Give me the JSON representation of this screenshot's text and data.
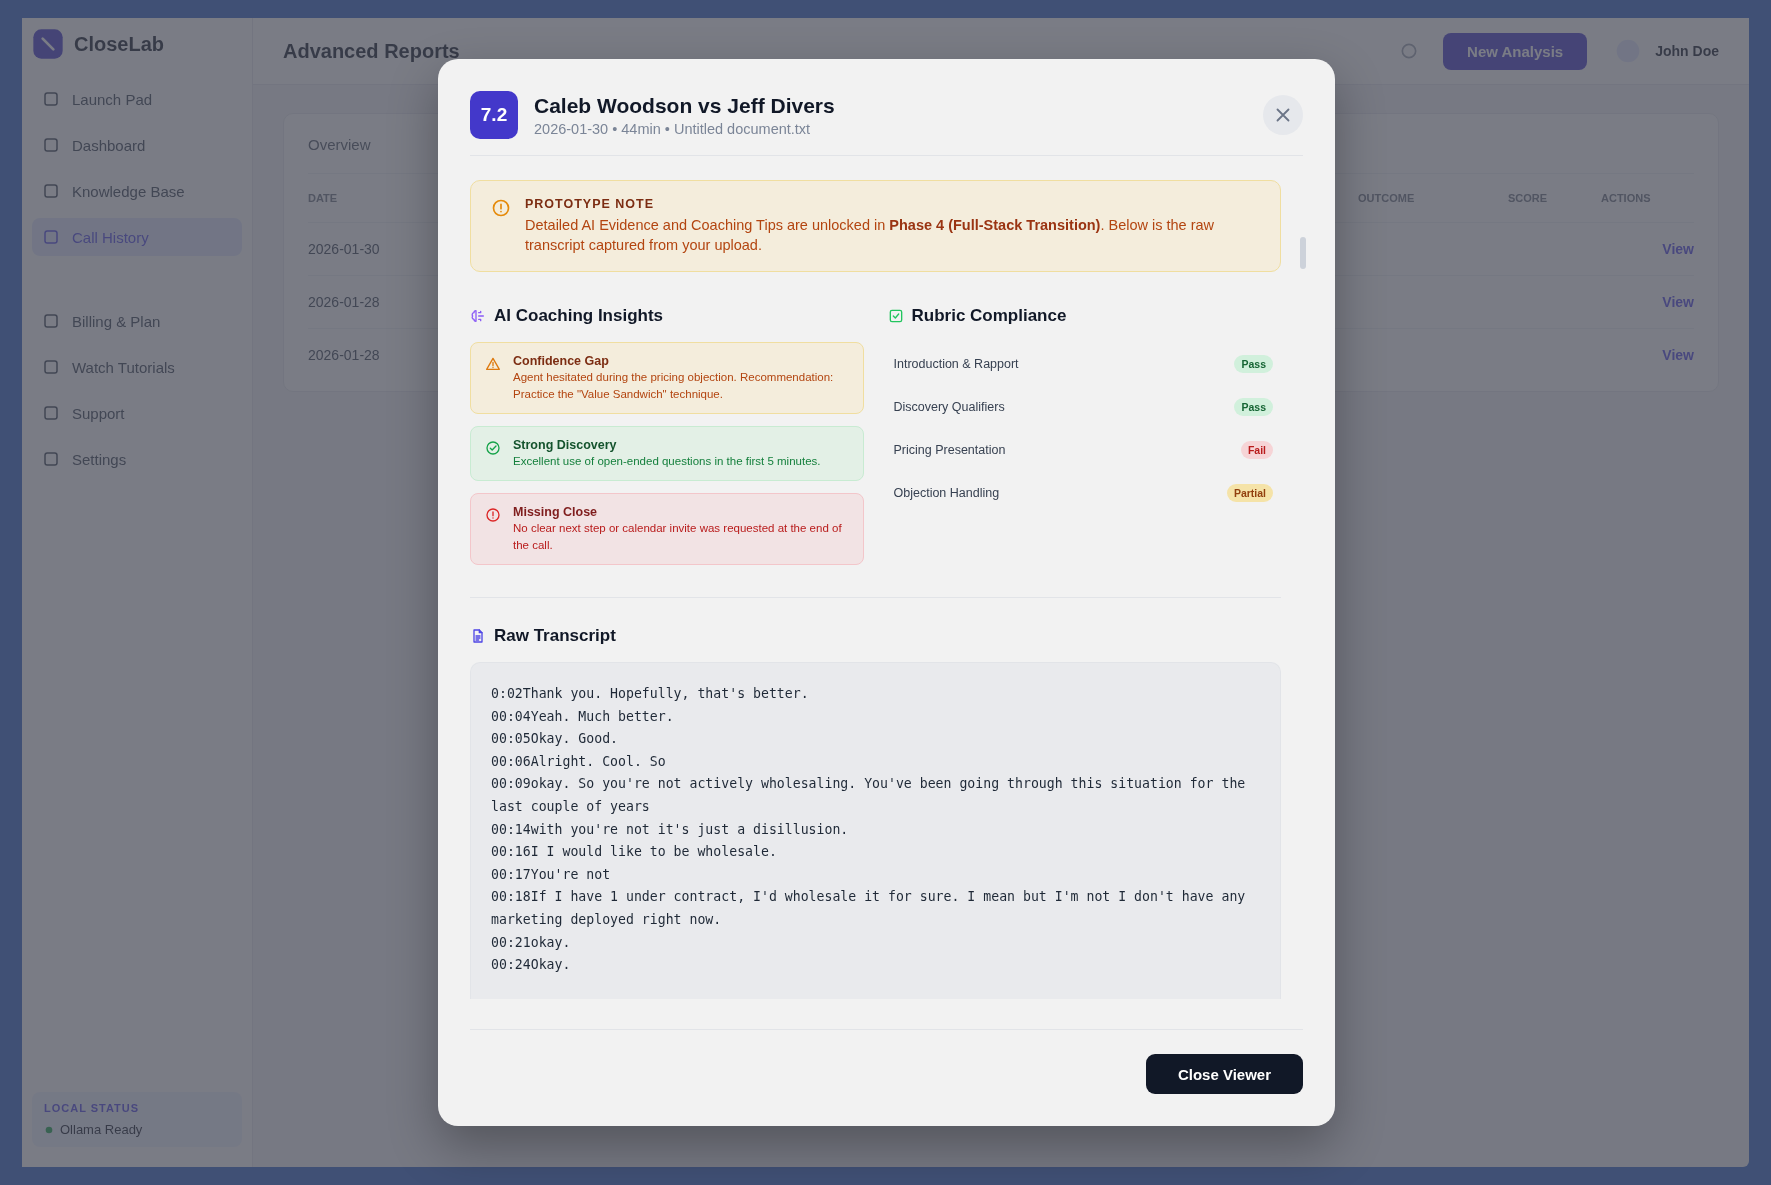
{
  "app": {
    "logo": "CloseLab",
    "page_title": "Advanced Reports",
    "primary_button": "New Analysis",
    "user_name": "John Doe",
    "nav": [
      {
        "label": "Launch Pad",
        "selected": false
      },
      {
        "label": "Dashboard",
        "selected": false
      },
      {
        "label": "Knowledge Base",
        "selected": false
      },
      {
        "label": "Call History",
        "selected": true
      },
      {
        "label": "Billing & Plan",
        "selected": false
      },
      {
        "label": "Watch Tutorials",
        "selected": false
      },
      {
        "label": "Support",
        "selected": false
      },
      {
        "label": "Settings",
        "selected": false
      }
    ],
    "local_status": {
      "label": "LOCAL STATUS",
      "value": "Ollama Ready"
    },
    "tabs": [
      "Overview"
    ],
    "table": {
      "columns": [
        "DATE",
        "OUTCOME",
        "SCORE",
        "ACTIONS"
      ],
      "rows": [
        {
          "date": "2026-01-30",
          "action": "View"
        },
        {
          "date": "2026-01-28",
          "action": "View"
        },
        {
          "date": "2026-01-28",
          "action": "View"
        }
      ]
    }
  },
  "modal": {
    "score": "7.2",
    "title": "Caleb Woodson vs Jeff Divers",
    "meta": "2026-01-30 • 44min • Untitled document.txt",
    "note": {
      "heading": "PROTOTYPE NOTE",
      "text": "Detailed AI Evidence and Coaching Tips are unlocked in **Phase 4 (Full-Stack Transition)**. Below is the raw transcript captured from your upload."
    },
    "insights": {
      "heading": "AI Coaching Insights",
      "items": [
        {
          "kind": "warning",
          "title": "Confidence Gap",
          "text": "Agent hesitated during the pricing objection. Recommendation: Practice the \"Value Sandwich\" technique."
        },
        {
          "kind": "success",
          "title": "Strong Discovery",
          "text": "Excellent use of open-ended questions in the first 5 minutes."
        },
        {
          "kind": "error",
          "title": "Missing Close",
          "text": "No clear next step or calendar invite was requested at the end of the call."
        }
      ]
    },
    "rubric": {
      "heading": "Rubric Compliance",
      "items": [
        {
          "label": "Introduction & Rapport",
          "result": "Pass",
          "kind": "pass"
        },
        {
          "label": "Discovery Qualifiers",
          "result": "Pass",
          "kind": "pass"
        },
        {
          "label": "Pricing Presentation",
          "result": "Fail",
          "kind": "fail"
        },
        {
          "label": "Objection Handling",
          "result": "Partial",
          "kind": "partial"
        }
      ]
    },
    "transcript": {
      "heading": "Raw Transcript",
      "lines": [
        "0:02Thank you. Hopefully, that's better.",
        "00:04Yeah. Much better.",
        "00:05Okay. Good.",
        "00:06Alright. Cool. So",
        "00:09okay. So you're not actively wholesaling. You've been going through this situation for the last couple of years",
        "00:14with you're not it's just a disillusion.",
        "00:16I I would like to be wholesale.",
        "00:17You're not",
        "00:18If I have 1 under contract, I'd wholesale it for sure. I mean but I'm not I don't have any marketing deployed right now.",
        "00:21okay.",
        "00:24Okay."
      ]
    },
    "close_button": "Close Viewer"
  }
}
